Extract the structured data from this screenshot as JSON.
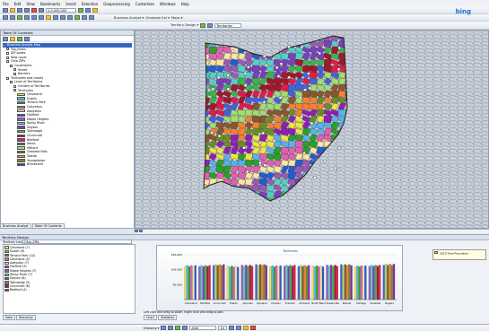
{
  "menu": [
    "File",
    "Edit",
    "View",
    "Bookmarks",
    "Insert",
    "Selection",
    "Geoprocessing",
    "Customize",
    "Windows",
    "Help"
  ],
  "toolbar": {
    "scale": "1:3,000,000",
    "business_analyst": "Business Analyst ▾",
    "ba_layer": "Graduate Ext ▾",
    "maps": "Maps ▾",
    "territory_design": "Territory Design ▾",
    "territories_select": "Territories"
  },
  "bing": "bing",
  "toc": {
    "title": "Table Of Contents",
    "items": [
      {
        "label": "Business Analyst Map",
        "indent": 0,
        "highlight": true
      },
      {
        "label": "Top_items",
        "indent": 1
      },
      {
        "label": "ZIP codes",
        "indent": 1
      },
      {
        "label": "New Layer",
        "indent": 1
      },
      {
        "label": "Ohio ZIPs",
        "indent": 1
      },
      {
        "label": "Constraints",
        "indent": 2
      },
      {
        "label": "Street",
        "indent": 3
      },
      {
        "label": "Barriers",
        "indent": 3
      },
      {
        "label": "Territories and Levels",
        "indent": 1
      },
      {
        "label": "Level of Territories",
        "indent": 2
      },
      {
        "label": "Centers of Territories",
        "indent": 3
      },
      {
        "label": "Territories",
        "indent": 3
      }
    ],
    "territories": [
      {
        "name": "Cleveland",
        "color": "#f0e442"
      },
      {
        "name": "Dublin",
        "color": "#56b4e9"
      },
      {
        "name": "Terrace Park",
        "color": "#2ca02c"
      },
      {
        "name": "Columbus",
        "color": "#e45fb0"
      },
      {
        "name": "Addyston",
        "color": "#ffe3a3"
      },
      {
        "name": "Fairfield",
        "color": "#1f5fd1"
      },
      {
        "name": "Maple Heights",
        "color": "#9b59b6"
      },
      {
        "name": "Rocky River",
        "color": "#55d0c9"
      },
      {
        "name": "Dayton",
        "color": "#7a3fbf"
      },
      {
        "name": "Tallmadge",
        "color": "#3cb44b"
      },
      {
        "name": "Cincinnati",
        "color": "#a2182c"
      },
      {
        "name": "Bedford",
        "color": "#e6194b"
      },
      {
        "name": "Xenia",
        "color": "#4363d8"
      },
      {
        "name": "Hilliard",
        "color": "#a1dd70"
      },
      {
        "name": "Olmsted Falls",
        "color": "#8b572a"
      },
      {
        "name": "Toledo",
        "color": "#f58231"
      },
      {
        "name": "Youngstown",
        "color": "#6b8e23"
      },
      {
        "name": "Brecksville",
        "color": "#911eb4"
      }
    ],
    "tabs": [
      "Business Analyst",
      "Table Of Contents"
    ]
  },
  "map_status": "",
  "territory_design": {
    "title": "Territory Design",
    "layer_label": "Territory Layer:",
    "layer_value": "Ohio ZIPs",
    "list": [
      {
        "name": "Cleveland (7)",
        "color": "#f0e442"
      },
      {
        "name": "Dublin (9)",
        "color": "#56b4e9"
      },
      {
        "name": "Terrace Park (10)",
        "color": "#2ca02c"
      },
      {
        "name": "Columbus (5)",
        "color": "#e45fb0"
      },
      {
        "name": "Addyston (7)",
        "color": "#ffe3a3"
      },
      {
        "name": "Fairfield (5)",
        "color": "#1f5fd1"
      },
      {
        "name": "Maple Heights (7)",
        "color": "#9b59b6"
      },
      {
        "name": "Rocky River (7)",
        "color": "#55d0c9"
      },
      {
        "name": "Dayton (6)",
        "color": "#7a3fbf"
      },
      {
        "name": "Tallmadge (5)",
        "color": "#3cb44b"
      },
      {
        "name": "Cincinnati (6)",
        "color": "#a2182c"
      },
      {
        "name": "Bedford (4)",
        "color": "#e6194b"
      }
    ],
    "bottom_tabs": [
      "Data",
      "Hierarchy"
    ],
    "hint": "Left click and drag to zoom. Right click and drag to pan.",
    "chart_tabs": [
      "Chart",
      "Statistics"
    ]
  },
  "chart_data": {
    "type": "bar",
    "title": "Territories",
    "ylabel": "",
    "ylim": [
      0,
      150000
    ],
    "yticks": [
      "150,000",
      "100,000",
      "50,000"
    ],
    "categories": [
      "Cleveland",
      "Fairfield",
      "Cincinnati",
      "Toledo",
      "Aquinas",
      "Sylvania",
      "Hudson",
      "Franklin",
      "Amherst",
      "North Bend",
      "Greenville",
      "Bolivar",
      "Portage",
      "Vandalia",
      "Rogers"
    ],
    "series": [
      {
        "name": "2010 Total Population",
        "values": [
          118000,
          117000,
          119000,
          116000,
          118000,
          119000,
          117000,
          118000,
          116000,
          117000,
          118000,
          119000,
          117000,
          118000,
          120000
        ]
      }
    ],
    "legend_position": "top-right"
  },
  "drawing": {
    "label": "Drawing ▾",
    "font": "Arial",
    "size": "10"
  }
}
